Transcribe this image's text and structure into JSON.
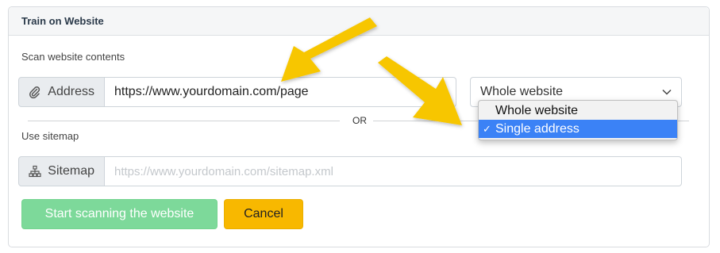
{
  "panel": {
    "title": "Train on Website"
  },
  "scan": {
    "label": "Scan website contents",
    "address_addon": "Address",
    "address_value": "https://www.yourdomain.com/page",
    "scope_selected": "Whole website",
    "scope_options": [
      "Whole website",
      "Single address"
    ],
    "scope_highlighted": "Single address"
  },
  "divider": {
    "text": "OR"
  },
  "sitemap": {
    "label": "Use sitemap",
    "addon": "Sitemap",
    "placeholder": "https://www.yourdomain.com/sitemap.xml"
  },
  "actions": {
    "start_label": "Start scanning the website",
    "cancel_label": "Cancel"
  },
  "colors": {
    "start_button": "#7dd99a",
    "cancel_button": "#f8b800",
    "highlight": "#3b82f6",
    "arrow": "#f7c600"
  },
  "icons": {
    "address": "paperclip-icon",
    "sitemap": "sitemap-icon",
    "select": "chevron-down-icon"
  }
}
